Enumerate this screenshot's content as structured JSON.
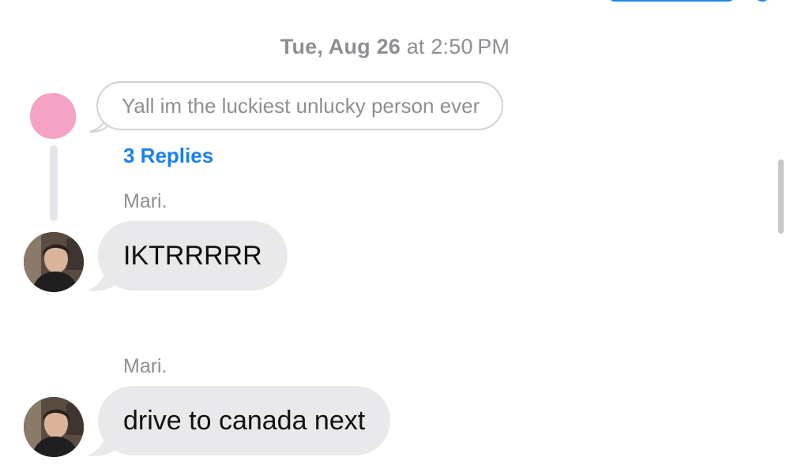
{
  "timestamp": {
    "date": "Tue, Aug 26",
    "time": "at 2:50 PM"
  },
  "quoted_message": {
    "text": "Yall im the luckiest unlucky person ever",
    "replies_label": "3 Replies"
  },
  "messages": [
    {
      "sender": "Mari.",
      "text": "IKTRRRRR"
    },
    {
      "sender": "Mari.",
      "text": "drive to canada next"
    }
  ],
  "colors": {
    "bubble_received": "#e9e9eb",
    "link_blue": "#1a7ff0",
    "meta_gray": "#8e8e93",
    "quote_avatar_pink": "#f4a3c5"
  }
}
